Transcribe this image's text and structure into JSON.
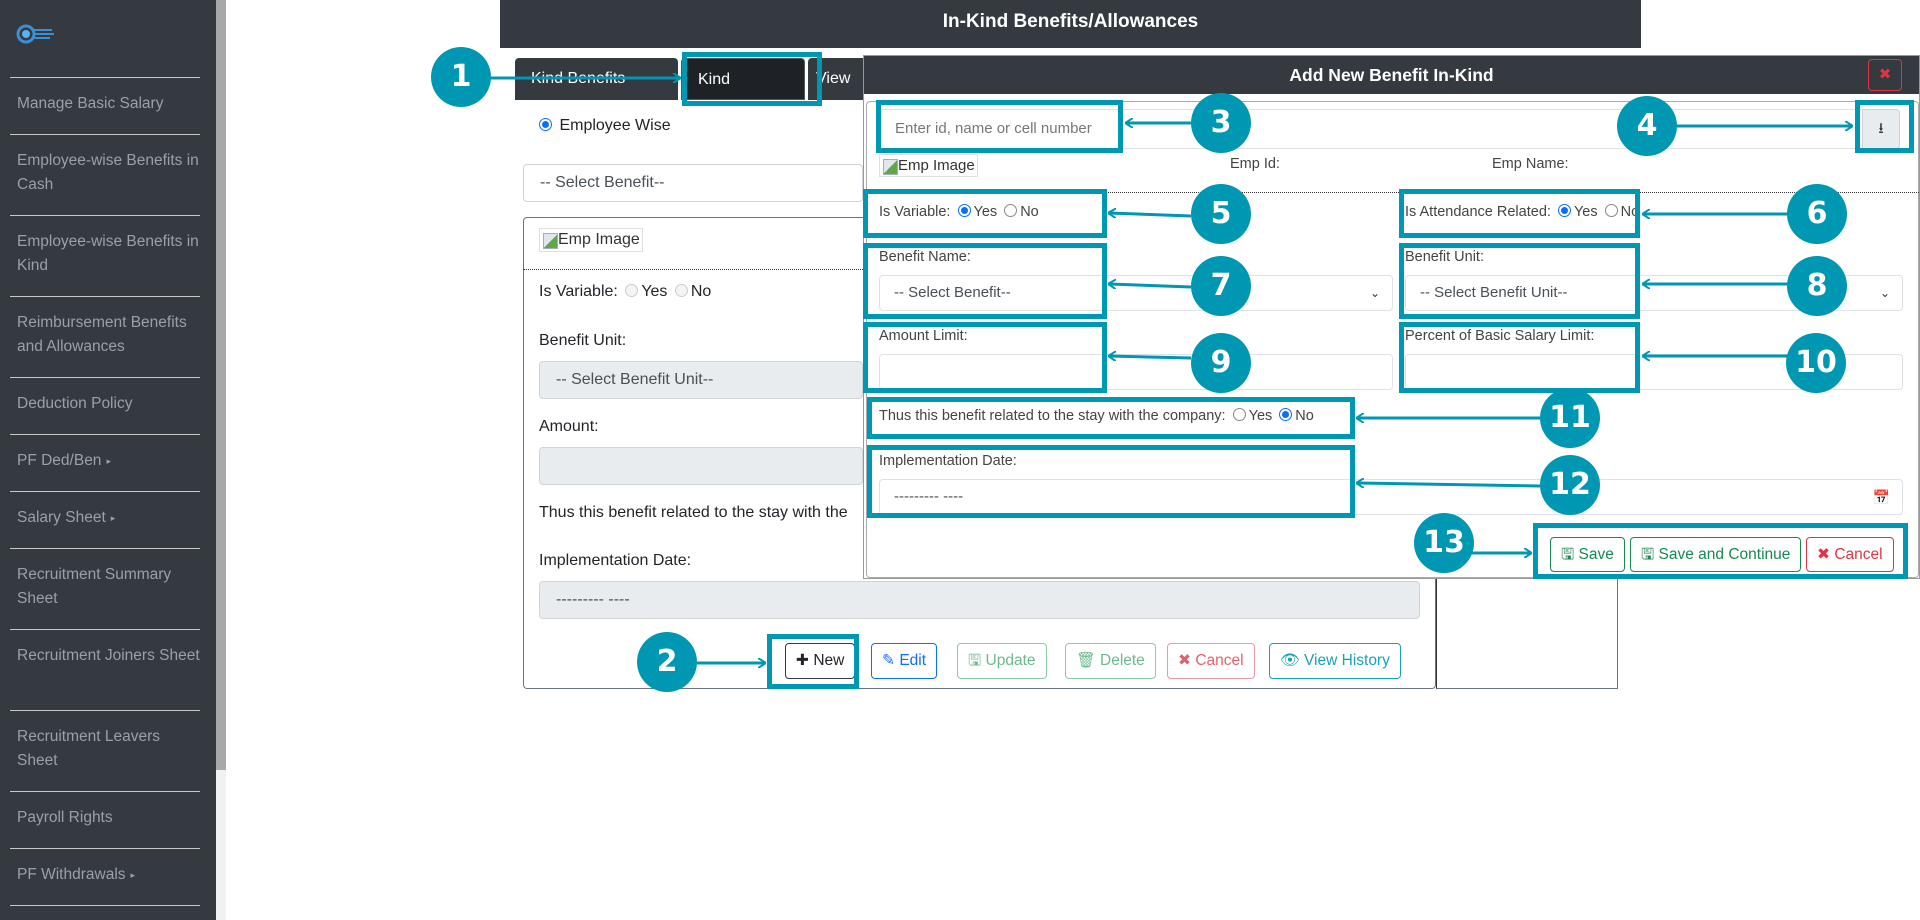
{
  "sidebar": {
    "logo": "hr-logo",
    "items": [
      {
        "label": "Manage Basic Salary",
        "has_submenu": false
      },
      {
        "label": "Employee-wise Benefits in Cash",
        "has_submenu": false
      },
      {
        "label": "Employee-wise Benefits in Kind",
        "has_submenu": false
      },
      {
        "label": "Reimbursement Benefits and Allowances",
        "has_submenu": false
      },
      {
        "label": "Deduction Policy",
        "has_submenu": false
      },
      {
        "label": "PF Ded/Ben",
        "has_submenu": true
      },
      {
        "label": "Salary Sheet",
        "has_submenu": true
      },
      {
        "label": "Recruitment Summary Sheet",
        "has_submenu": false
      },
      {
        "label": "Recruitment Joiners Sheet",
        "has_submenu": false
      },
      {
        "label": "Recruitment Leavers Sheet",
        "has_submenu": false
      },
      {
        "label": "Payroll Rights",
        "has_submenu": false
      },
      {
        "label": "PF Withdrawals",
        "has_submenu": true
      }
    ],
    "caret": "▸"
  },
  "header": {
    "title": "In-Kind Benefits/Allowances"
  },
  "tabs": [
    {
      "label": "Kind Benefits Type",
      "active": false
    },
    {
      "label": "Kind Benefits",
      "active": true
    },
    {
      "label": "View",
      "active": false
    }
  ],
  "background_form": {
    "mode_radio": "Employee Wise",
    "benefit_select": "-- Select Benefit--",
    "emp_image_alt": "Emp Image",
    "is_variable_label": "Is Variable:",
    "yes": "Yes",
    "no": "No",
    "benefit_unit_label": "Benefit Unit:",
    "benefit_unit_select": "-- Select Benefit Unit--",
    "amount_label": "Amount:",
    "amount_value": "",
    "stay_label": "Thus this benefit related to the stay with the",
    "impl_date_label": "Implementation Date:",
    "impl_date_value": "--------- ----",
    "buttons": {
      "new": "New",
      "edit": "Edit",
      "update": "Update",
      "delete": "Delete",
      "cancel": "Cancel",
      "view_history": "View History"
    }
  },
  "modal": {
    "title": "Add New Benefit In-Kind",
    "close": "✖",
    "search_placeholder": "Enter id, name or cell number",
    "emp_image_alt": "Emp Image",
    "emp_id_label": "Emp Id:",
    "emp_name_label": "Emp Name:",
    "is_variable_label": "Is Variable:",
    "is_variable_value": "Yes",
    "is_attendance_label": "Is Attendance Related:",
    "is_attendance_value": "Yes",
    "yes": "Yes",
    "no": "No",
    "benefit_name_label": "Benefit Name:",
    "benefit_name_select": "-- Select Benefit--",
    "benefit_unit_label": "Benefit Unit:",
    "benefit_unit_select": "-- Select Benefit Unit--",
    "amount_limit_label": "Amount Limit:",
    "amount_limit_value": "",
    "percent_limit_label": "Percent of Basic Salary Limit:",
    "percent_limit_value": "",
    "stay_label": "Thus this benefit related to the stay with the company:",
    "stay_value": "No",
    "impl_date_label": "Implementation Date:",
    "impl_date_value": "--------- ----",
    "buttons": {
      "save": "Save",
      "save_continue": "Save and Continue",
      "cancel": "Cancel"
    }
  },
  "annotations": {
    "accent_color": "#0097b2",
    "badges": [
      "1",
      "2",
      "3",
      "4",
      "5",
      "6",
      "7",
      "8",
      "9",
      "10",
      "11",
      "12",
      "13"
    ]
  },
  "icons": {
    "plus": "✚",
    "edit": "✎",
    "save": "🖫",
    "trash": "🗑",
    "cancel": "✖",
    "eye": "👁",
    "download": "⭳",
    "calendar": "📅",
    "chevron": "⌄"
  }
}
